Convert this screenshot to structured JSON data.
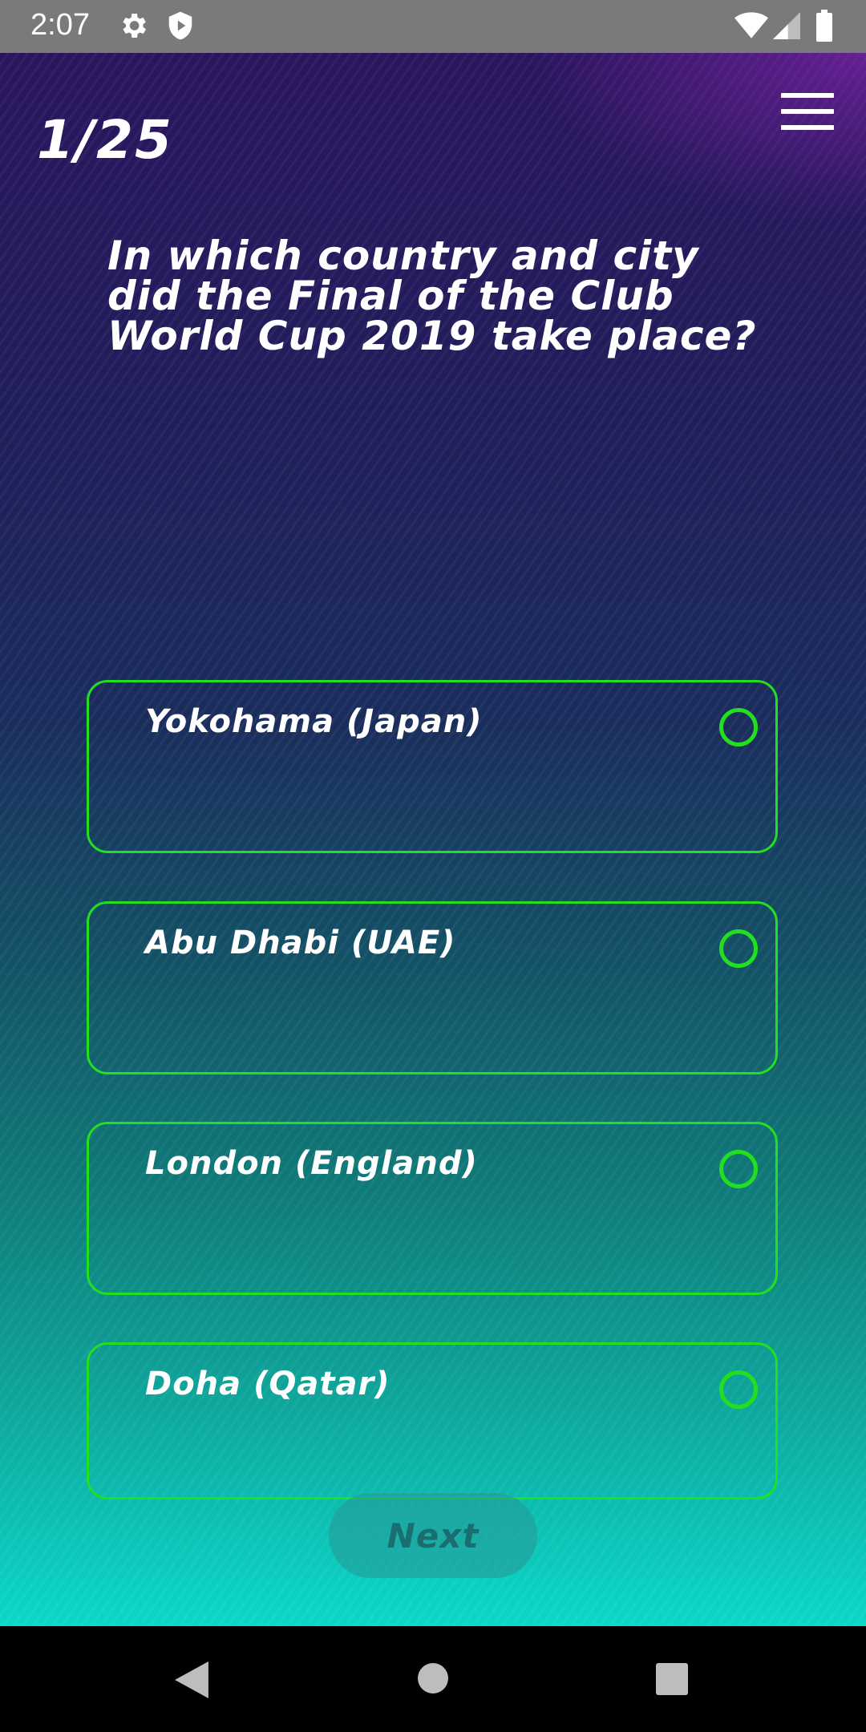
{
  "status_bar": {
    "time": "2:07",
    "icons_left": [
      "gear-icon",
      "shield-icon"
    ],
    "icons_right": [
      "wifi-icon",
      "signal-icon",
      "battery-icon"
    ]
  },
  "quiz": {
    "counter": "1/25",
    "question": "In which country and city did the Final of the Club World Cup 2019 take place?",
    "answers": [
      {
        "label": "Yokohama (Japan)"
      },
      {
        "label": "Abu Dhabi (UAE)"
      },
      {
        "label": "London (England)"
      },
      {
        "label": "Doha (Qatar)"
      }
    ],
    "next_label": "Next",
    "accent_color": "#23e01f"
  },
  "nav_bar": {
    "buttons": [
      "back-icon",
      "home-icon",
      "recents-icon"
    ]
  }
}
